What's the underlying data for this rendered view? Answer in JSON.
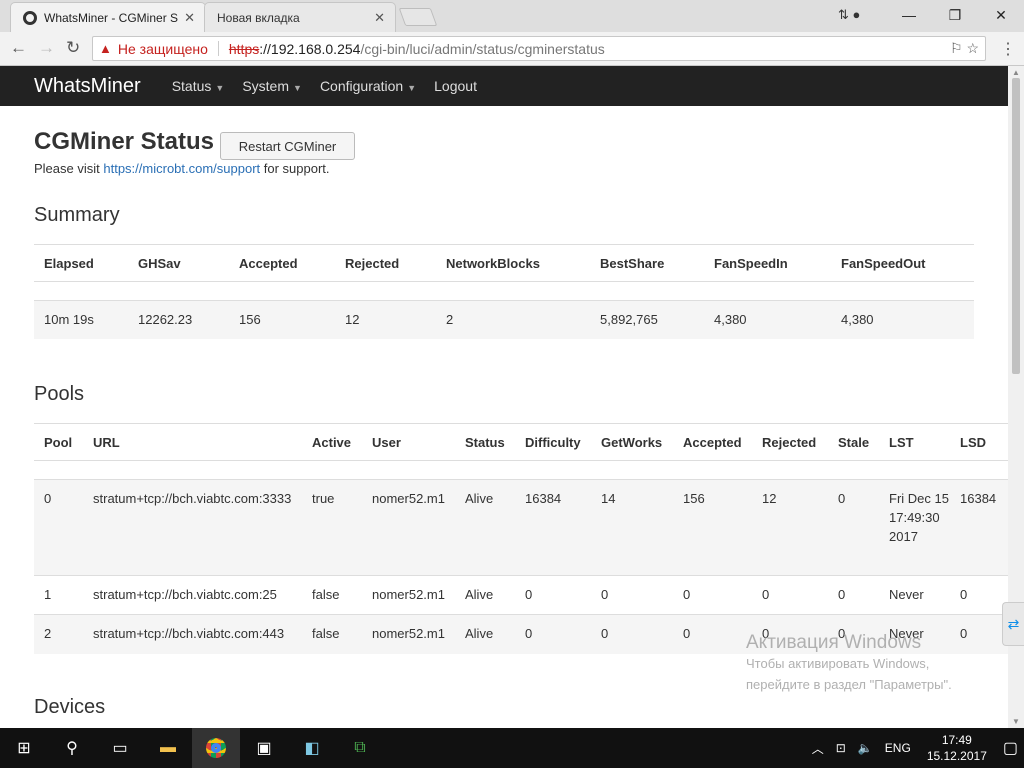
{
  "browser": {
    "tabs": [
      {
        "title": "WhatsMiner - CGMiner S",
        "active": true
      },
      {
        "title": "Новая вкладка",
        "active": false
      }
    ],
    "omnibox": {
      "security_label": "Не защищено",
      "scheme": "https",
      "host": "://192.168.0.254",
      "path": "/cgi-bin/luci/admin/status/cgminerstatus"
    }
  },
  "navbar": {
    "brand": "WhatsMiner",
    "items": [
      "Status",
      "System",
      "Configuration",
      "Logout"
    ]
  },
  "page": {
    "title": "CGMiner Status",
    "restart_label": "Restart CGMiner",
    "visit_prefix": "Please visit ",
    "visit_link": "https://microbt.com/support",
    "visit_suffix": " for support."
  },
  "summary": {
    "heading": "Summary",
    "columns": [
      "Elapsed",
      "GHSav",
      "Accepted",
      "Rejected",
      "NetworkBlocks",
      "BestShare",
      "FanSpeedIn",
      "FanSpeedOut"
    ],
    "row": [
      "10m 19s",
      "12262.23",
      "156",
      "12",
      "2",
      "5,892,765",
      "4,380",
      "4,380"
    ]
  },
  "pools": {
    "heading": "Pools",
    "columns": [
      "Pool",
      "URL",
      "Active",
      "User",
      "Status",
      "Difficulty",
      "GetWorks",
      "Accepted",
      "Rejected",
      "Stale",
      "LST",
      "LSD"
    ],
    "rows": [
      [
        "0",
        "stratum+tcp://bch.viabtc.com:3333",
        "true",
        "nomer52.m1",
        "Alive",
        "16384",
        "14",
        "156",
        "12",
        "0",
        "Fri Dec 15 17:49:30 2017",
        "16384"
      ],
      [
        "1",
        "stratum+tcp://bch.viabtc.com:25",
        "false",
        "nomer52.m1",
        "Alive",
        "0",
        "0",
        "0",
        "0",
        "0",
        "Never",
        "0"
      ],
      [
        "2",
        "stratum+tcp://bch.viabtc.com:443",
        "false",
        "nomer52.m1",
        "Alive",
        "0",
        "0",
        "0",
        "0",
        "0",
        "Never",
        "0"
      ]
    ]
  },
  "devices": {
    "heading": "Devices"
  },
  "watermark": {
    "line1": "Активация Windows",
    "line2": "Чтобы активировать Windows,",
    "line3": "перейдите в раздел \"Параметры\"."
  },
  "taskbar": {
    "language": "ENG",
    "time": "17:49",
    "date": "15.12.2017"
  }
}
